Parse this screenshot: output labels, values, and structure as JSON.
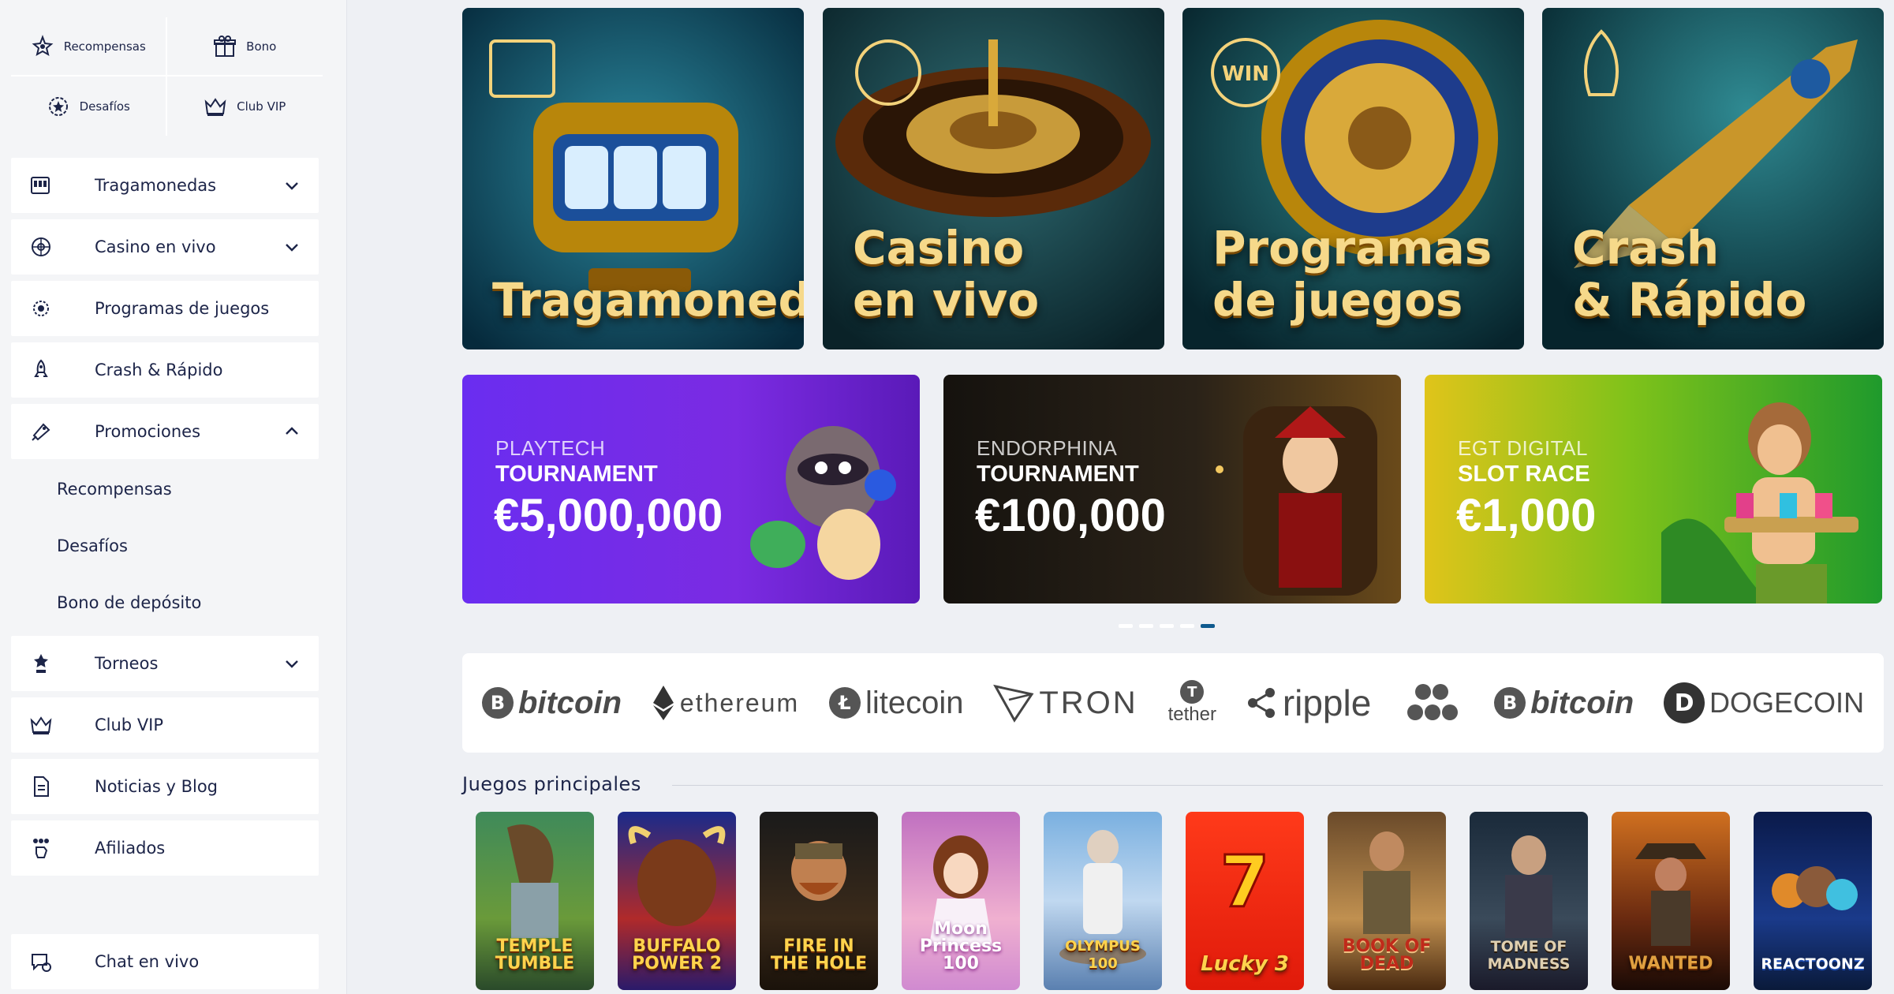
{
  "sidebar": {
    "quick_links": [
      {
        "label": "Recompensas",
        "icon": "star-burst-icon"
      },
      {
        "label": "Bono",
        "icon": "gift-icon"
      },
      {
        "label": "Desafíos",
        "icon": "badge-star-icon"
      },
      {
        "label": "Club VIP",
        "icon": "crown-icon"
      }
    ],
    "nav": [
      {
        "label": "Tragamonedas",
        "icon": "slot-machine-icon",
        "chevron": "down"
      },
      {
        "label": "Casino en vivo",
        "icon": "roulette-icon",
        "chevron": "down"
      },
      {
        "label": "Programas de juegos",
        "icon": "wheel-icon",
        "chevron": ""
      },
      {
        "label": "Crash & Rápido",
        "icon": "rocket-icon",
        "chevron": ""
      },
      {
        "label": "Promociones",
        "icon": "ticket-icon",
        "chevron": "up"
      },
      {
        "label": "Torneos",
        "icon": "trophy-icon",
        "chevron": "down"
      },
      {
        "label": "Club VIP",
        "icon": "crown-icon",
        "chevron": ""
      },
      {
        "label": "Noticias y Blog",
        "icon": "document-icon",
        "chevron": ""
      },
      {
        "label": "Afiliados",
        "icon": "affiliates-icon",
        "chevron": ""
      },
      {
        "label": "Chat en vivo",
        "icon": "chat-icon",
        "chevron": ""
      }
    ],
    "promo_sub": [
      "Recompensas",
      "Desafíos",
      "Bono de depósito"
    ]
  },
  "categories": [
    {
      "line1": "Tragamonedas",
      "line2": ""
    },
    {
      "line1": "Casino",
      "line2": "en vivo"
    },
    {
      "line1": "Programas",
      "line2": "de juegos"
    },
    {
      "line1": "Crash",
      "line2": "& Rápido"
    }
  ],
  "promos": [
    {
      "provider": "PLAYTECH",
      "kind": "TOURNAMENT",
      "amount": "€5,000,000"
    },
    {
      "provider": "ENDORPHINA",
      "kind": "TOURNAMENT",
      "amount": "€100,000"
    },
    {
      "provider": "EGT DIGITAL",
      "kind": "SLOT RACE",
      "amount": "€1,000"
    }
  ],
  "carousel": {
    "total": 5,
    "active": 5
  },
  "payments": [
    {
      "name": "bitcoin",
      "mark": "B"
    },
    {
      "name": "ethereum",
      "mark": ""
    },
    {
      "name": "litecoin",
      "mark": "Ł"
    },
    {
      "name": "TRON",
      "mark": ""
    },
    {
      "name": "tether",
      "mark": "T"
    },
    {
      "name": "ripple",
      "mark": ""
    },
    {
      "name": "",
      "mark": ""
    },
    {
      "name": "bitcoin",
      "mark": "B"
    },
    {
      "name": "DOGECOIN",
      "mark": "D"
    }
  ],
  "games_section": {
    "title": "Juegos principales"
  },
  "games": [
    {
      "name": "TEMPLE TUMBLE"
    },
    {
      "name": "BUFFALO POWER 2"
    },
    {
      "name": "FIRE IN THE HOLE"
    },
    {
      "name": "Moon Princess 100"
    },
    {
      "name": "OLYMPUS 100"
    },
    {
      "name": "Lucky 3"
    },
    {
      "name": "BOOK OF DEAD"
    },
    {
      "name": "TOME OF MADNESS"
    },
    {
      "name": "WANTED"
    },
    {
      "name": "REACTOONZ"
    }
  ]
}
